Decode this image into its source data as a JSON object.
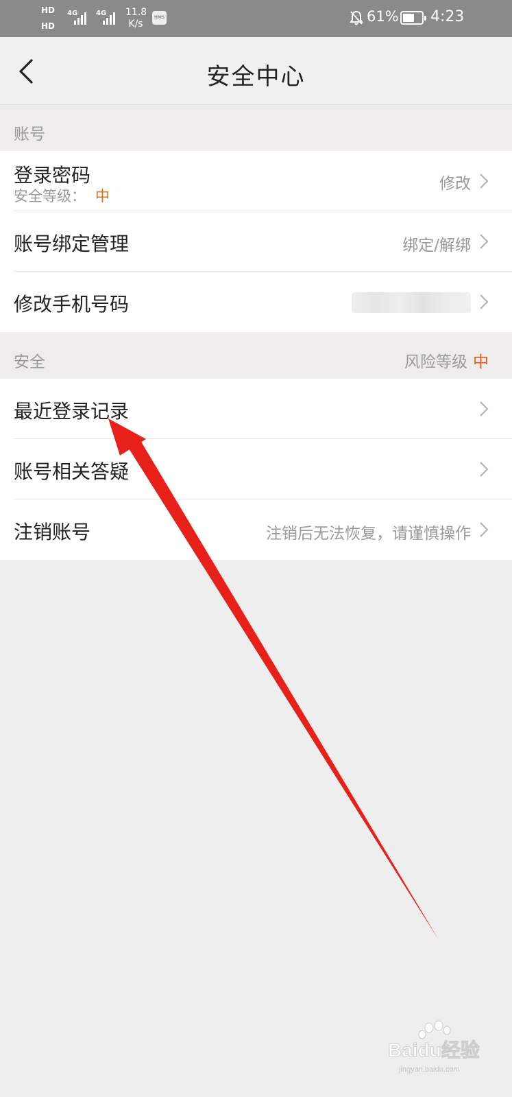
{
  "status_bar": {
    "hd_1": "HD",
    "hd_2": "HD",
    "network_1": "4G",
    "network_2": "4G",
    "speed_value": "11.8",
    "speed_unit": "K/s",
    "hms_badge": "HMS",
    "battery_percent": "61%",
    "battery_level": 0.61,
    "time": "4:23",
    "icons": [
      "hd-icon",
      "signal-icon",
      "hms-icon",
      "bell-off-icon",
      "battery-icon"
    ]
  },
  "nav": {
    "title": "安全中心",
    "back_icon": "back-chevron-icon"
  },
  "account_section": {
    "header": "账号",
    "login_password": {
      "title": "登录密码",
      "level_label": "安全等级：",
      "level_value": "中",
      "action": "修改"
    },
    "binding": {
      "title": "账号绑定管理",
      "action": "绑定/解绑"
    },
    "phone": {
      "title": "修改手机号码"
    }
  },
  "security_section": {
    "header": "安全",
    "risk_label": "风险等级",
    "risk_value": "中",
    "recent_login": {
      "title": "最近登录记录"
    },
    "faq": {
      "title": "账号相关答疑"
    },
    "cancel": {
      "title": "注销账号",
      "hint": "注销后无法恢复，请谨慎操作"
    }
  },
  "colors": {
    "accent_orange": "#d8741c",
    "risk_orange": "#e25a1f",
    "annotation_red": "#e8201a"
  },
  "watermark": {
    "text": "Baidu经验",
    "url": "jingyan.baidu.com"
  }
}
